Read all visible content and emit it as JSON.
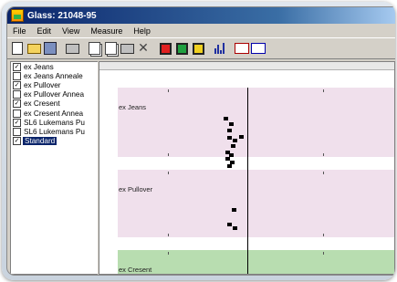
{
  "window": {
    "title": "Glass: 21048-95"
  },
  "menu": [
    "File",
    "Edit",
    "View",
    "Measure",
    "Help"
  ],
  "toolbar": {
    "buttons": [
      {
        "name": "new-file-icon"
      },
      {
        "name": "open-folder-icon"
      },
      {
        "name": "save-icon"
      },
      {
        "name": "sep"
      },
      {
        "name": "print-icon"
      },
      {
        "name": "sep"
      },
      {
        "name": "copy-icon"
      },
      {
        "name": "paste-icon"
      },
      {
        "name": "properties-icon"
      },
      {
        "name": "delete-icon"
      },
      {
        "name": "sep"
      },
      {
        "name": "zoom-red-icon"
      },
      {
        "name": "zoom-green-icon"
      },
      {
        "name": "zoom-yellow-icon"
      },
      {
        "name": "sep"
      },
      {
        "name": "bar-chart-icon"
      },
      {
        "name": "sep"
      },
      {
        "name": "compare-icon"
      },
      {
        "name": "compare-alt-icon"
      }
    ]
  },
  "samples": [
    {
      "label": "ex Jeans",
      "checked": true,
      "selected": false
    },
    {
      "label": "ex Jeans Anneale",
      "checked": false,
      "selected": false
    },
    {
      "label": "ex Pullover",
      "checked": true,
      "selected": false
    },
    {
      "label": "ex Pullover Annea",
      "checked": false,
      "selected": false
    },
    {
      "label": "ex Cresent",
      "checked": true,
      "selected": false
    },
    {
      "label": "ex Cresent Annea",
      "checked": false,
      "selected": false
    },
    {
      "label": "SL6 Lukemans Pu",
      "checked": true,
      "selected": false
    },
    {
      "label": "SL6 Lukemans Pu",
      "checked": false,
      "selected": false
    },
    {
      "label": "Standard",
      "checked": true,
      "selected": true
    }
  ],
  "plot": {
    "bands": [
      {
        "label": "ex Jeans",
        "color": "#f0e0ec"
      },
      {
        "label": "ex Pullover",
        "color": "#f0e0ec"
      },
      {
        "label": "ex Cresent",
        "color": "#b8ddb0"
      }
    ],
    "reference_line_color": "#000000"
  }
}
